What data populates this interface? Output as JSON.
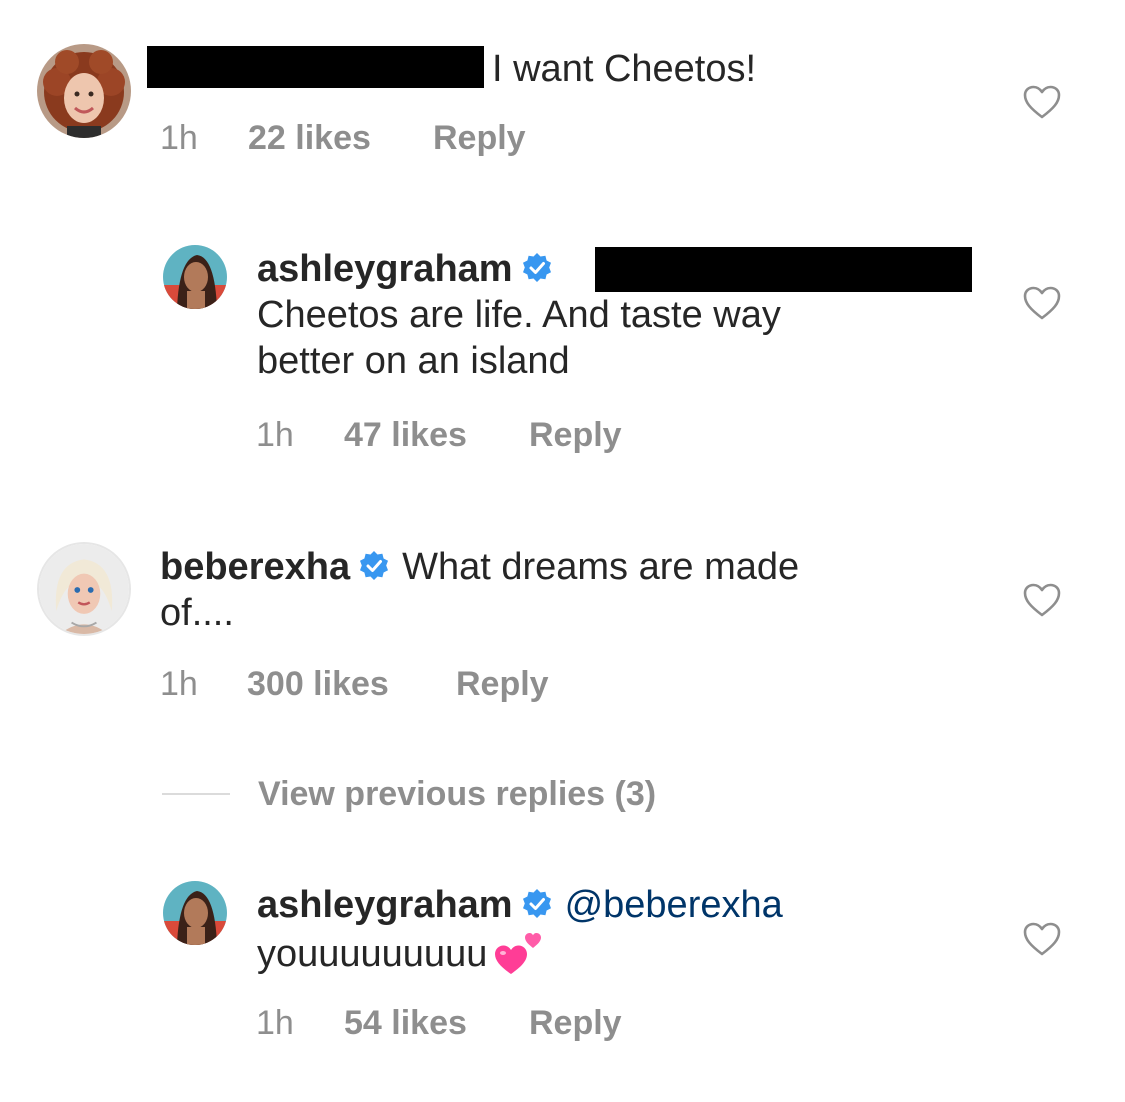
{
  "colors": {
    "text": "#262626",
    "meta": "#8e8e8e",
    "mention": "#003569",
    "verified": "#3897f0",
    "heart_outline": "#8e8e8e"
  },
  "comments": [
    {
      "avatar": "user-avatar-curly-hair",
      "username_redacted": true,
      "text": "I want Cheetos!",
      "time": "1h",
      "likes": "22 likes",
      "reply": "Reply"
    },
    {
      "avatar": "ashleygraham-avatar",
      "username": "ashleygraham",
      "verified": true,
      "mention_redacted": true,
      "text_line1": "Cheetos are life. And taste way",
      "text_line2": "better on an island",
      "time": "1h",
      "likes": "47 likes",
      "reply": "Reply"
    },
    {
      "avatar": "beberexha-avatar",
      "username": "beberexha",
      "verified": true,
      "text_line1": "What dreams are made",
      "text_line2": "of....",
      "time": "1h",
      "likes": "300 likes",
      "reply": "Reply"
    },
    {
      "avatar": "ashleygraham-avatar",
      "username": "ashleygraham",
      "verified": true,
      "mention": "@beberexha",
      "text_line2": "youuuuuuuuu",
      "emoji": "two-hearts",
      "time": "1h",
      "likes": "54 likes",
      "reply": "Reply"
    }
  ],
  "view_previous_replies": "View previous replies (3)",
  "icons": {
    "like": "heart-outline-icon",
    "verified": "verified-badge-icon"
  }
}
